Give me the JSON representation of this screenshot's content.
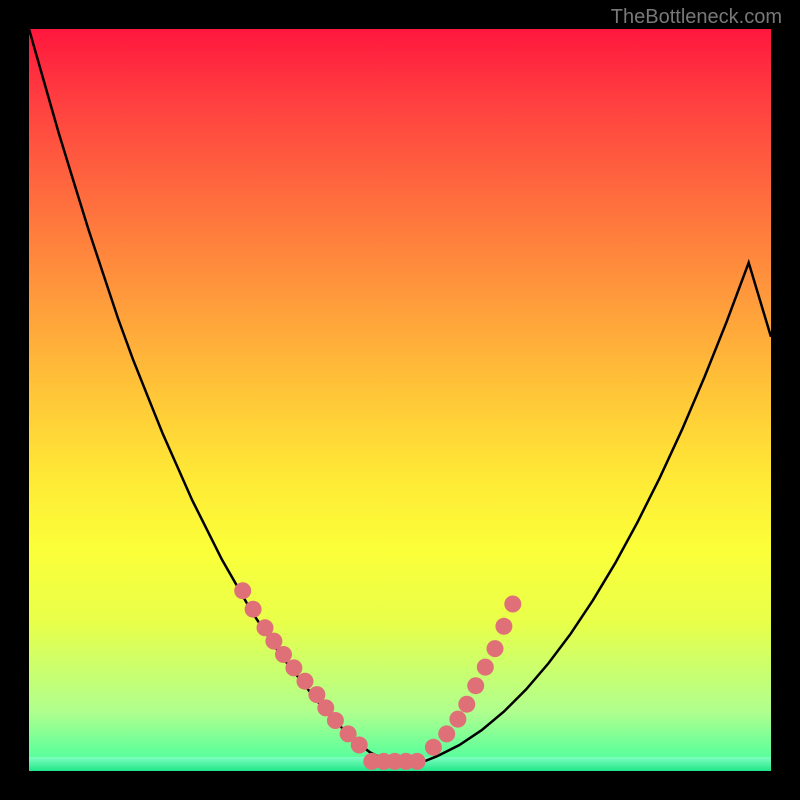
{
  "watermark": "TheBottleneck.com",
  "colors": {
    "curve": "#000000",
    "dot": "#e07078",
    "frame": "#000000"
  },
  "chart_data": {
    "type": "line",
    "title": "",
    "xlabel": "",
    "ylabel": "",
    "xlim": [
      0,
      100
    ],
    "ylim": [
      0,
      100
    ],
    "curve": {
      "x": [
        0,
        2,
        4,
        6,
        8,
        10,
        12,
        14,
        16,
        18,
        20,
        22,
        24,
        26,
        28,
        30,
        32,
        34,
        36,
        38,
        40,
        42,
        44,
        46,
        48,
        49.5,
        51,
        53,
        55,
        58,
        61,
        64,
        67,
        70,
        73,
        76,
        79,
        82,
        85,
        88,
        91,
        94,
        97,
        100
      ],
      "y": [
        100,
        93,
        86,
        79.5,
        73,
        67,
        61,
        55.5,
        50.5,
        45.5,
        41,
        36.5,
        32.5,
        28.5,
        25,
        21.5,
        18.5,
        15.5,
        13,
        10.5,
        8,
        6,
        4,
        2.5,
        1.5,
        1,
        1,
        1.2,
        2,
        3.5,
        5.5,
        8,
        11,
        14.5,
        18.5,
        23,
        28,
        33.5,
        39.5,
        46,
        53,
        60.5,
        68.5,
        58.5
      ]
    },
    "series": [
      {
        "name": "left-dot-cluster",
        "type": "scatter",
        "x": [
          28.8,
          30.2,
          31.8,
          33.0,
          34.3,
          35.7,
          37.2,
          38.8,
          40.0,
          41.3,
          43.0,
          44.5
        ],
        "y": [
          24.3,
          21.8,
          19.3,
          17.5,
          15.7,
          13.9,
          12.1,
          10.3,
          8.5,
          6.8,
          5.0,
          3.5
        ]
      },
      {
        "name": "right-dot-cluster",
        "type": "scatter",
        "x": [
          54.5,
          56.3,
          57.8,
          59.0,
          60.2,
          61.5,
          62.8,
          64.0,
          65.2
        ],
        "y": [
          3.2,
          5.0,
          7.0,
          9.0,
          11.5,
          14.0,
          16.5,
          19.5,
          22.5
        ]
      },
      {
        "name": "bottom-flat-cluster",
        "type": "scatter",
        "x": [
          46.2,
          47.8,
          49.3,
          50.8,
          52.3
        ],
        "y": [
          1.3,
          1.3,
          1.3,
          1.3,
          1.3
        ]
      }
    ]
  }
}
